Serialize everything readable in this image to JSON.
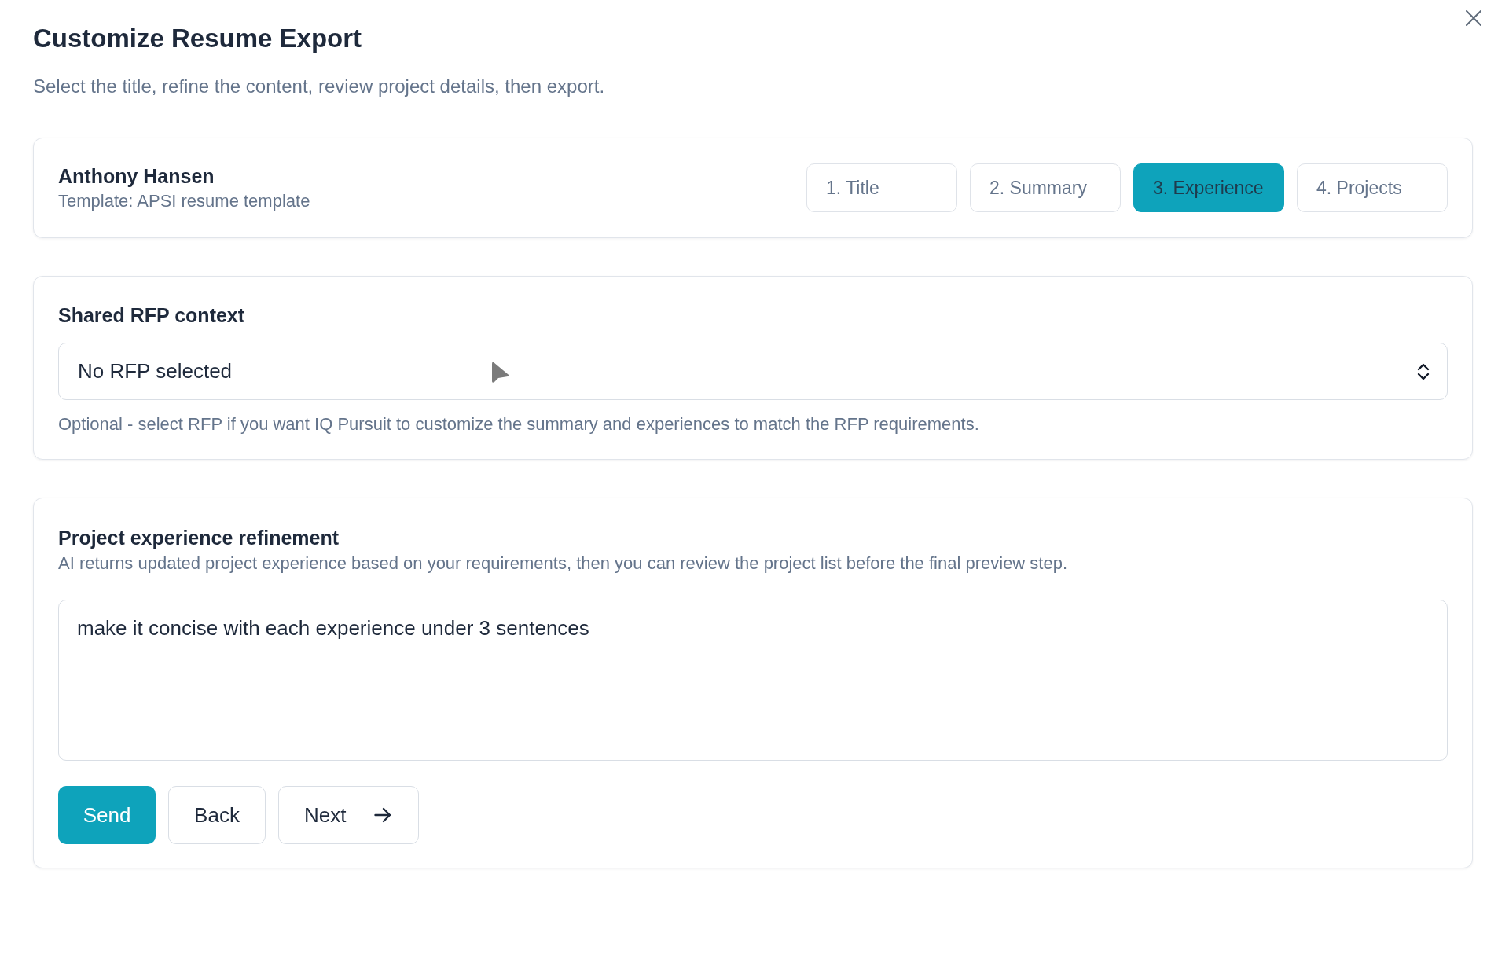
{
  "dialog": {
    "title": "Customize Resume Export",
    "subtitle": "Select the title, refine the content, review project details, then export."
  },
  "candidate": {
    "name": "Anthony Hansen",
    "template": "Template: APSI resume template"
  },
  "steps": [
    {
      "label": "1. Title",
      "selected": false
    },
    {
      "label": "2. Summary",
      "selected": false
    },
    {
      "label": "3. Experience",
      "selected": true
    },
    {
      "label": "4. Projects",
      "selected": false
    }
  ],
  "rfp_context": {
    "heading": "Shared RFP context",
    "select": {
      "value": "No RFP selected"
    },
    "helper": "Optional - select RFP if you want IQ Pursuit to customize the summary and experiences to match the RFP requirements."
  },
  "refinement": {
    "heading": "Project experience refinement",
    "description": "AI returns updated project experience based on your requirements, then you can review the project list before the final preview step.",
    "prompt": {
      "value": "make it concise with each experience under 3 sentences"
    },
    "buttons": [
      {
        "label": "Send",
        "kind": "primary"
      },
      {
        "label": "Back",
        "kind": "secondary"
      },
      {
        "label": "Next",
        "kind": "forward"
      }
    ]
  }
}
